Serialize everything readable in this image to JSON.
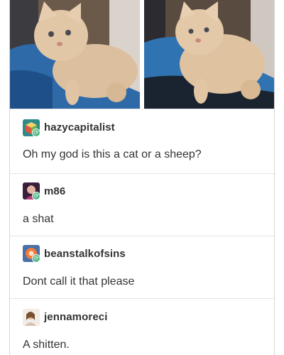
{
  "post": {
    "photos": [
      {
        "alt_icon": "curly-cat-photo-1"
      },
      {
        "alt_icon": "curly-cat-photo-2"
      }
    ],
    "thread": [
      {
        "username": "hazycapitalist",
        "text": "Oh my god is this a cat or a sheep?",
        "avatar_icon": "cube-avatar-icon",
        "badge": "⟳"
      },
      {
        "username": "m86",
        "text": "a shat",
        "avatar_icon": "portrait-avatar-icon",
        "badge": "⟳"
      },
      {
        "username": "beanstalkofsins",
        "text": "Dont call it that please",
        "avatar_icon": "orange-circle-avatar-icon",
        "badge": "⟳"
      },
      {
        "username": "jennamoreci",
        "text": "A shitten.",
        "avatar_icon": "photo-avatar-icon",
        "badge": ""
      }
    ]
  },
  "colors": {
    "text": "#333333",
    "reblog_badge": "#56bc8a",
    "divider": "#e4e4e4"
  }
}
